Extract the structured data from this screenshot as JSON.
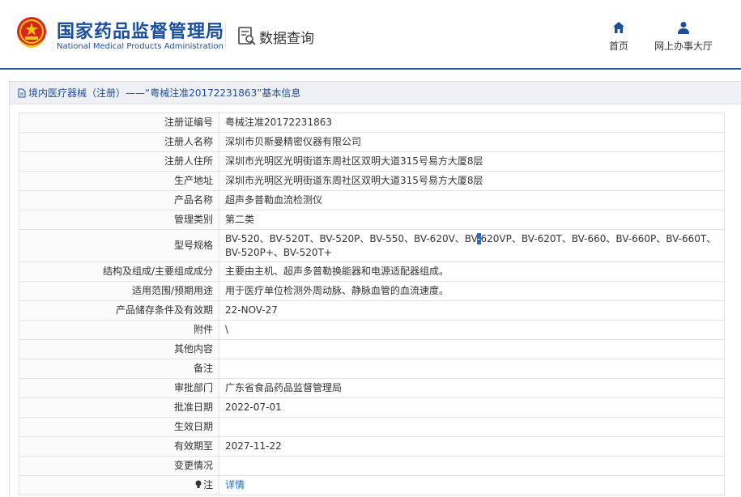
{
  "header": {
    "brand_cn": "国家药品监督管理局",
    "brand_en": "National Medical Products Administration",
    "query_title": "数据查询",
    "nav": [
      {
        "label": "首页",
        "icon": "home-icon"
      },
      {
        "label": "网上办事大厅",
        "icon": "user-icon"
      }
    ]
  },
  "panel": {
    "title": "境内医疗器械（注册）——“粤械注准20172231863”基本信息"
  },
  "fields": [
    {
      "key": "注册证编号",
      "value": "粤械注准20172231863"
    },
    {
      "key": "注册人名称",
      "value": "深圳市贝斯曼精密仪器有限公司"
    },
    {
      "key": "注册人住所",
      "value": "深圳市光明区光明街道东周社区双明大道315号易方大厦8层"
    },
    {
      "key": "生产地址",
      "value": "深圳市光明区光明街道东周社区双明大道315号易方大厦8层"
    },
    {
      "key": "产品名称",
      "value": "超声多普勒血流检测仪"
    },
    {
      "key": "管理类别",
      "value": "第二类"
    },
    {
      "key": "型号规格",
      "value_a": "BV-520、BV-520T、BV-520P、BV-550、BV-620V、BV",
      "value_hl": "-",
      "value_b": "620VP、BV-620T、BV-660、BV-660P、BV-660T、BV-520P+、BV-520T+"
    },
    {
      "key": "结构及组成/主要组成成分",
      "value": "主要由主机、超声多普勒换能器和电源适配器组成。"
    },
    {
      "key": "适用范围/预期用途",
      "value": "用于医疗单位检测外周动脉、静脉血管的血流速度。"
    },
    {
      "key": "产品储存条件及有效期",
      "value": "22-NOV-27"
    },
    {
      "key": "附件",
      "value": "\\"
    },
    {
      "key": "其他内容",
      "value": ""
    },
    {
      "key": "备注",
      "value": ""
    },
    {
      "key": "审批部门",
      "value": "广东省食品药品监督管理局"
    },
    {
      "key": "批准日期",
      "value": "2022-07-01"
    },
    {
      "key": "生效日期",
      "value": ""
    },
    {
      "key": "有效期至",
      "value": "2027-11-22"
    },
    {
      "key": "变更情况",
      "value": ""
    },
    {
      "key": "注",
      "value": "详情"
    }
  ],
  "colors": {
    "brand": "#1b4e9b",
    "link": "#1e6bb8",
    "emblem_red": "#d7261e",
    "emblem_gold": "#f5c518"
  }
}
